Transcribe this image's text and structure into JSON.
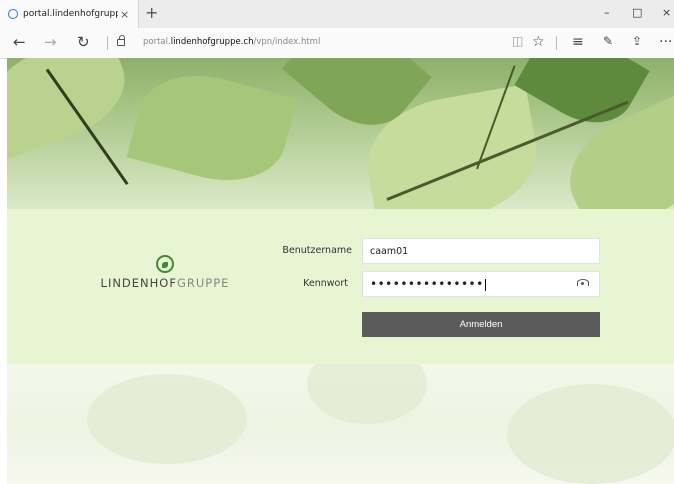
{
  "browser": {
    "tab_title": "portal.lindenhofgruppe.",
    "tab_close": "×",
    "new_tab": "+",
    "window_controls": [
      "–",
      "□",
      "×"
    ],
    "back": "←",
    "forward": "→",
    "refresh": "↻",
    "url_prefix": "portal.",
    "url_host": "lindenhofgruppe.ch",
    "url_path": "/vpn/index.html",
    "toolbar_icons": [
      "reading-view-icon",
      "favorite-star-icon",
      "hub-icon",
      "web-note-icon",
      "share-icon",
      "more-icon"
    ],
    "more_label": "···"
  },
  "login": {
    "logo_bold": "LINDENHOF",
    "logo_light": "GRUPPE",
    "username_label": "Benutzername",
    "username_value": "caam01",
    "password_label": "Kennwort",
    "password_value": "•••••••••••••••",
    "submit_label": "Anmelden"
  },
  "colors": {
    "panel_bg": "#e8f5d2",
    "button_bg": "#5b5b5b",
    "brand_green": "#3f8a3a"
  }
}
